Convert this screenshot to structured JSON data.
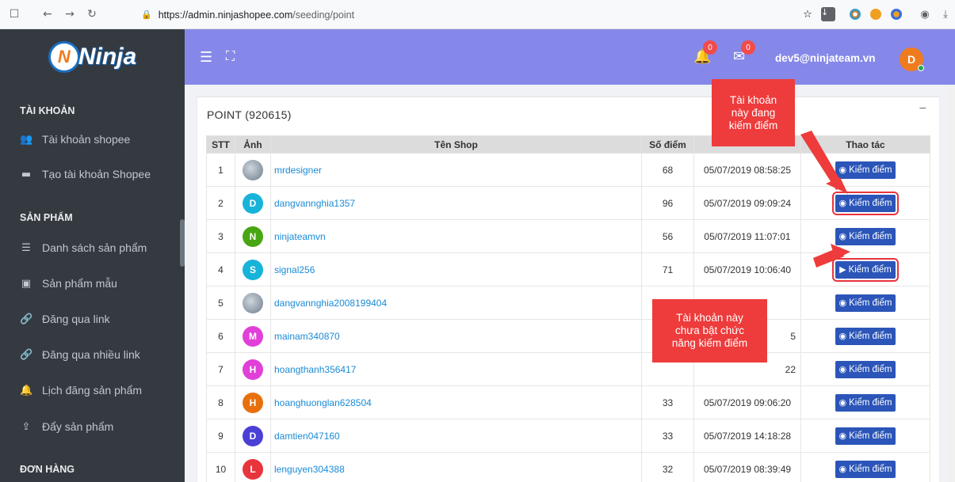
{
  "browser": {
    "url_host": "https://admin.ninjashopee.com",
    "url_path": "/seeding/point"
  },
  "brand": {
    "logo_text": "Ninja",
    "logo_mark": "N"
  },
  "sidebar": {
    "sections": [
      {
        "label": "TÀI KHOẢN"
      },
      {
        "label": "SẢN PHẨM"
      },
      {
        "label": "ĐƠN HÀNG"
      }
    ],
    "items": [
      {
        "label": "Tài khoản shopee",
        "icon": "users-icon"
      },
      {
        "label": "Tạo tài khoản Shopee",
        "icon": "store-icon"
      },
      {
        "label": "Danh sách sản phẩm",
        "icon": "list-icon"
      },
      {
        "label": "Sản phẩm mẫu",
        "icon": "excel-file-icon"
      },
      {
        "label": "Đăng qua link",
        "icon": "link-icon"
      },
      {
        "label": "Đăng qua nhiều link",
        "icon": "link-icon"
      },
      {
        "label": "Lịch đăng sản phẩm",
        "icon": "bell-icon"
      },
      {
        "label": "Đẩy sản phẩm",
        "icon": "upload-icon"
      }
    ]
  },
  "header": {
    "notifications_count": "0",
    "messages_count": "0",
    "user_email": "dev5@ninjateam.vn",
    "user_initial": "D"
  },
  "card": {
    "title": "POINT (920615)",
    "collapse": "−"
  },
  "table": {
    "headers": [
      "STT",
      "Ảnh",
      "Tên Shop",
      "Số điểm",
      "",
      "Thao tác"
    ],
    "action_label": "Kiểm điểm",
    "rows": [
      {
        "stt": "1",
        "avatar": "",
        "avatar_color": "photo",
        "name": "mrdesigner",
        "points": "68",
        "date": "05/07/2019 08:58:25",
        "state": "on"
      },
      {
        "stt": "2",
        "avatar": "D",
        "avatar_color": "#17b3d9",
        "name": "dangvannghia1357",
        "points": "96",
        "date": "05/07/2019 09:09:24",
        "state": "on"
      },
      {
        "stt": "3",
        "avatar": "N",
        "avatar_color": "#49a613",
        "name": "ninjateamvn",
        "points": "56",
        "date": "05/07/2019 11:07:01",
        "state": "on"
      },
      {
        "stt": "4",
        "avatar": "S",
        "avatar_color": "#17b3d9",
        "name": "signal256",
        "points": "71",
        "date": "05/07/2019 10:06:40",
        "state": "off"
      },
      {
        "stt": "5",
        "avatar": "",
        "avatar_color": "photo",
        "name": "dangvannghia2008199404",
        "points": "",
        "date": "",
        "state": "on"
      },
      {
        "stt": "6",
        "avatar": "M",
        "avatar_color": "#e040d8",
        "name": "mainam340870",
        "points": "",
        "date": "5",
        "state": "on"
      },
      {
        "stt": "7",
        "avatar": "H",
        "avatar_color": "#e040d8",
        "name": "hoangthanh356417",
        "points": "",
        "date": "22",
        "state": "on"
      },
      {
        "stt": "8",
        "avatar": "H",
        "avatar_color": "#e8700c",
        "name": "hoanghuonglan628504",
        "points": "33",
        "date": "05/07/2019 09:06:20",
        "state": "on"
      },
      {
        "stt": "9",
        "avatar": "D",
        "avatar_color": "#4a3fd6",
        "name": "damtien047160",
        "points": "33",
        "date": "05/07/2019 14:18:28",
        "state": "on"
      },
      {
        "stt": "10",
        "avatar": "L",
        "avatar_color": "#e8343c",
        "name": "lenguyen304388",
        "points": "32",
        "date": "05/07/2019 08:39:49",
        "state": "on"
      }
    ]
  },
  "callouts": {
    "active": "Tài khoản này đang kiếm điểm",
    "inactive": "Tài khoản này chưa bật chức năng kiếm điểm"
  }
}
